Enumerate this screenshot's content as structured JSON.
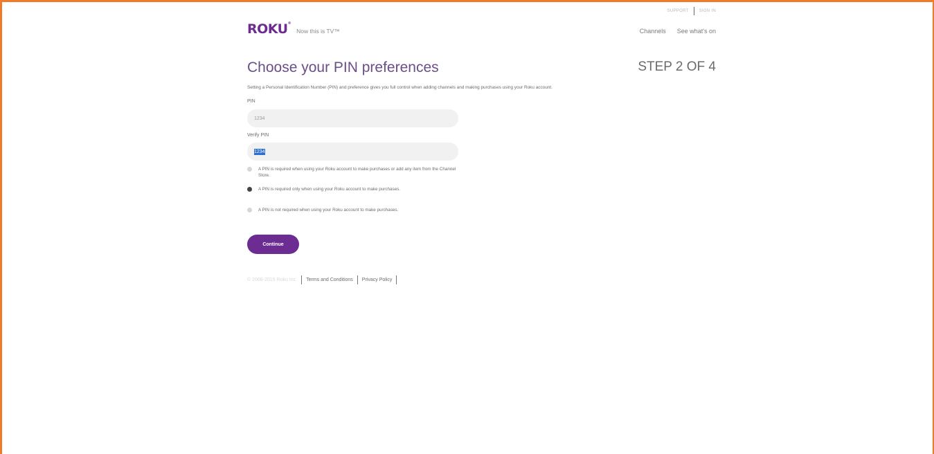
{
  "util_links": {
    "support": "SUPPORT",
    "sign_in": "SIGN IN"
  },
  "brand": {
    "logo": "ROKU",
    "tagline": "Now this is TV™"
  },
  "nav": {
    "channels": "Channels",
    "whats_on": "See what's on"
  },
  "page": {
    "title": "Choose your PIN preferences",
    "step": "STEP 2 OF 4",
    "intro": "Setting a Personal Identification Number (PIN) and preference gives you full control when adding channels and making purchases using your Roku account."
  },
  "form": {
    "pin_label": "PIN",
    "pin_value": "1234",
    "verify_label": "Verify PIN",
    "verify_value": "1234",
    "options": [
      {
        "text": "A PIN is required when using your Roku account to make purchases or add any item from the Channel Store.",
        "selected": false
      },
      {
        "text": "A PIN is required only when using your Roku account to make purchases.",
        "selected": true
      },
      {
        "text": "A PIN is not required when using your Roku account to make purchases.",
        "selected": false
      }
    ],
    "continue_label": "Continue"
  },
  "footer": {
    "copyright": "© 2008-2015 Roku Inc.",
    "terms": "Terms and Conditions",
    "privacy": "Privacy Policy"
  },
  "colors": {
    "brand_purple": "#6c2c91",
    "frame_orange": "#ef7b2a",
    "selection_blue": "#2a6fd1"
  }
}
